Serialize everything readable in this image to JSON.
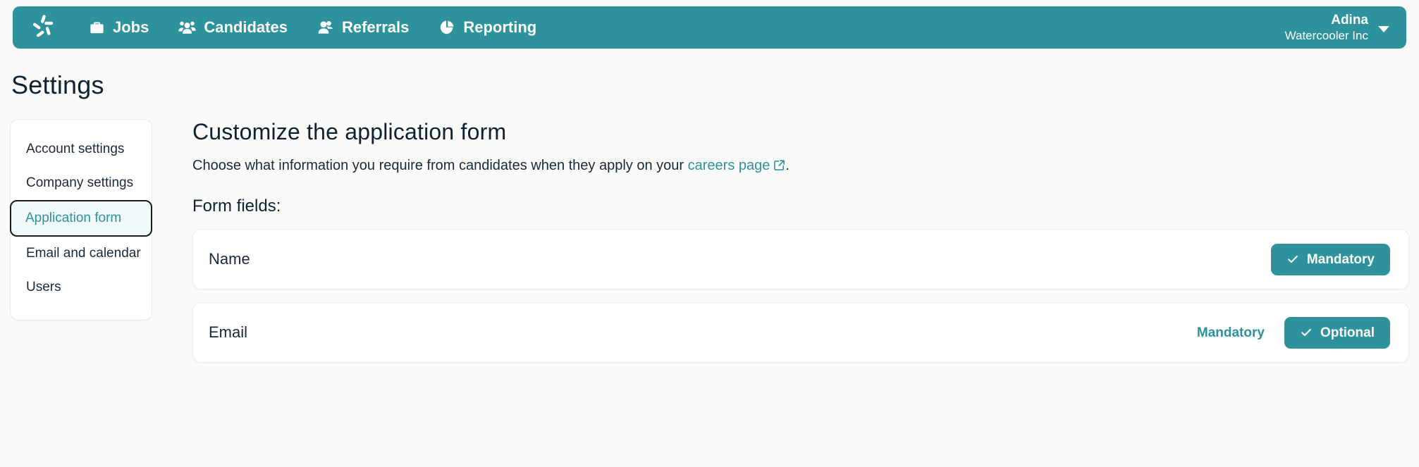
{
  "nav": {
    "logo_icon": "pinwheel-logo-icon",
    "items": [
      {
        "label": "Jobs",
        "icon": "briefcase-icon"
      },
      {
        "label": "Candidates",
        "icon": "people-group-icon"
      },
      {
        "label": "Referrals",
        "icon": "two-people-icon"
      },
      {
        "label": "Reporting",
        "icon": "pie-chart-icon"
      }
    ],
    "user": {
      "name": "Adina",
      "organization": "Watercooler Inc",
      "caret_icon": "chevron-down-icon"
    }
  },
  "page": {
    "title": "Settings"
  },
  "sidebar": {
    "items": [
      {
        "label": "Account settings",
        "active": false
      },
      {
        "label": "Company settings",
        "active": false
      },
      {
        "label": "Application form",
        "active": true
      },
      {
        "label": "Email and calendar",
        "active": false
      },
      {
        "label": "Users",
        "active": false
      }
    ]
  },
  "main": {
    "heading": "Customize the application form",
    "subtitle_before": "Choose what information you require from candidates when they apply on your ",
    "subtitle_link": "careers page",
    "subtitle_after": ".",
    "link_icon": "external-link-icon",
    "form_fields_label": "Form fields:",
    "fields": [
      {
        "name": "Name",
        "options": [
          {
            "label": "Mandatory",
            "selected": true,
            "icon": "check-icon"
          }
        ]
      },
      {
        "name": "Email",
        "options": [
          {
            "label": "Mandatory",
            "selected": false,
            "icon": "check-icon"
          },
          {
            "label": "Optional",
            "selected": true,
            "icon": "check-icon"
          }
        ]
      }
    ]
  },
  "colors": {
    "brand_teal": "#2e929c",
    "page_background": "#fafaf9",
    "text_dark": "#0e2233",
    "active_item_background": "#f1f9fa"
  }
}
